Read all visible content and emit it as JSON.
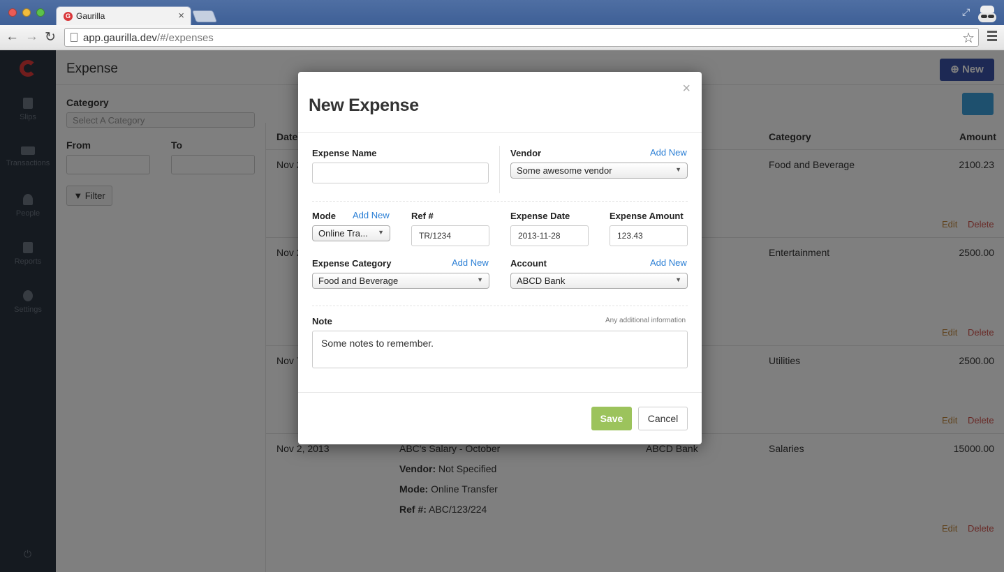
{
  "browser": {
    "tab_title": "Gaurilla",
    "tab_favicon": "G",
    "tab_close": "×",
    "url_host": "app.gaurilla.dev",
    "url_path": "/#/expenses",
    "back_glyph": "←",
    "forward_glyph": "→",
    "reload_glyph": "↻",
    "star_glyph": "☆",
    "fullscreen_glyph": "⤢"
  },
  "sidebar": {
    "items": [
      {
        "label": "Slips",
        "icon": "document-icon"
      },
      {
        "label": "Transactions",
        "icon": "money-icon"
      },
      {
        "label": "People",
        "icon": "person-icon"
      },
      {
        "label": "Reports",
        "icon": "report-icon"
      },
      {
        "label": "Settings",
        "icon": "gear-icon"
      }
    ],
    "power_glyph": "⏻"
  },
  "page": {
    "title": "Expense",
    "new_button": "⊕ New",
    "filter": {
      "category_label": "Category",
      "category_placeholder": "Select A Category",
      "from_label": "From",
      "to_label": "To",
      "filter_button": "▼ Filter"
    },
    "table": {
      "headers": {
        "date": "Date",
        "category": "Category",
        "amount": "Amount"
      },
      "rows": [
        {
          "date": "Nov 2",
          "category": "Food and Beverage",
          "amount": "2100.23"
        },
        {
          "date": "Nov 2",
          "category": "Entertainment",
          "amount": "2500.00"
        },
        {
          "date": "Nov 7",
          "category": "Utilities",
          "amount": "2500.00"
        },
        {
          "date": "Nov 2, 2013",
          "category": "Salaries",
          "amount": "15000.00",
          "title": "ABC's Salary - October",
          "account": "ABCD Bank",
          "vendor_label": "Vendor:",
          "vendor": "Not Specified",
          "mode_label": "Mode:",
          "mode": "Online Transfer",
          "ref_label": "Ref #:",
          "ref": "ABC/123/224"
        }
      ],
      "edit_label": "Edit",
      "delete_label": "Delete"
    }
  },
  "modal": {
    "title": "New Expense",
    "close": "×",
    "add_new": "Add New",
    "expense_name": {
      "label": "Expense Name",
      "value": ""
    },
    "vendor": {
      "label": "Vendor",
      "value": "Some awesome vendor"
    },
    "mode": {
      "label": "Mode",
      "value": "Online Tra..."
    },
    "ref": {
      "label": "Ref #",
      "value": "TR/1234"
    },
    "expense_date": {
      "label": "Expense Date",
      "value": "2013-11-28"
    },
    "expense_amount": {
      "label": "Expense Amount",
      "value": "123.43"
    },
    "expense_category": {
      "label": "Expense Category",
      "value": "Food and Beverage"
    },
    "account": {
      "label": "Account",
      "value": "ABCD Bank"
    },
    "note": {
      "label": "Note",
      "hint": "Any additional information",
      "value": "Some notes to remember."
    },
    "save": "Save",
    "cancel": "Cancel"
  },
  "colors": {
    "save": "#9cc35c",
    "link": "#2b7fd5",
    "new_button": "#3a52a8",
    "sidebar": "#2b3440"
  }
}
